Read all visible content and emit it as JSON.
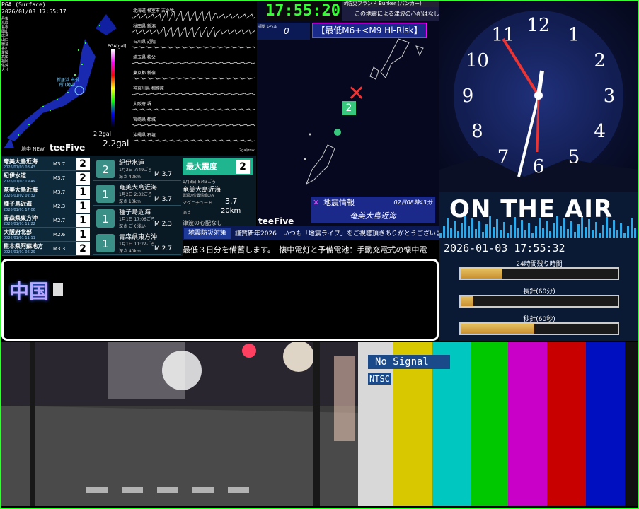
{
  "pga": {
    "header": "PGA (Surface)",
    "datetime": "2026/01/03 17:55:17",
    "legend": [
      "丹後",
      "鳥取",
      "島根",
      "岡山",
      "広島",
      "山口",
      "徳島",
      "香川",
      "愛媛",
      "高知",
      "福岡",
      "佐賀",
      "大分"
    ],
    "scale_label": "PGA[gal]",
    "gal_small": "2.2gal",
    "place": "新居浜 市役所 (地中)"
  },
  "waveforms": {
    "stations": [
      "北海道 根室市 古小牧",
      "秋田県 新潟",
      "石川県 近院",
      "埼玉県 秩父",
      "東京都 新宿",
      "神奈川県 相模原",
      "大阪府 堺",
      "宮崎県 都城",
      "沖縄県 石垣"
    ],
    "gal_big": "2.2gal",
    "brand": "teeFive",
    "new_label": "地中 NEW",
    "unit": "2gal/row"
  },
  "eq_list": [
    {
      "name": "奄美大島近海",
      "date": "2026/01/03 08:43",
      "mag": "M3.7",
      "shindo": "2"
    },
    {
      "name": "紀伊水道",
      "date": "2026/01/02 19:49",
      "mag": "M3.7",
      "shindo": "2"
    },
    {
      "name": "奄美大島近海",
      "date": "2026/01/02 02:32",
      "mag": "M3.7",
      "shindo": "1"
    },
    {
      "name": "種子島近海",
      "date": "2026/01/01 17:06",
      "mag": "M2.3",
      "shindo": "1"
    },
    {
      "name": "青森県東方沖",
      "date": "2026/01/01 11:22",
      "mag": "M2.7",
      "shindo": "1"
    },
    {
      "name": "大阪府北部",
      "date": "2026/01/01 11:11",
      "mag": "M2.6",
      "shindo": "1"
    },
    {
      "name": "熊本県阿蘇地方",
      "date": "2026/01/01 06:29",
      "mag": "M3.3",
      "shindo": "2"
    }
  ],
  "eq_detail": [
    {
      "name": "紀伊水道",
      "date": "1月2日 7:49ごろ",
      "depth": "深さ 40km",
      "mag": "M 3.7",
      "shindo": "2"
    },
    {
      "name": "奄美大島近海",
      "date": "1月2日 2:32ごろ",
      "depth": "深さ 10km",
      "mag": "M 3.7",
      "shindo": "1"
    },
    {
      "name": "種子島近海",
      "date": "1月1日 17:06ごろ",
      "depth": "深さ ごく浅い",
      "mag": "M 2.3",
      "shindo": "1"
    },
    {
      "name": "青森県東方沖",
      "date": "1月1日 11:22ごろ",
      "depth": "深さ 40km",
      "mag": "M 2.7",
      "shindo": "1"
    }
  ],
  "eq_info": {
    "max_label": "最大震度",
    "max_value": "2",
    "time": "1月3日 8:43ごろ",
    "place": "奄美大島近海",
    "note": "震源の位置情報のみ",
    "mag_label": "マグニチュード",
    "mag_value": "3.7",
    "depth_label": "深さ",
    "depth_value": "20km",
    "tsunami": "津波の心配なし"
  },
  "map": {
    "clock": "17:55:20",
    "bunker": "#防災ブランド Bunker (バンカー)",
    "tsunami": "この地震による津波の心配はなし",
    "level_label": "振動 レベル",
    "level_value": "0",
    "risk": "【最低M6+<M9 Hi-Risk】",
    "marker_shindo": "2",
    "info_title": "地震情報",
    "info_time": "02日08時43分",
    "info_loc": "奄美大島近海",
    "brand": "teeFive"
  },
  "ticker": {
    "label": "地震防災対策",
    "line1": "謹賀新年2026　いつも「地震ライブ」をご視聴頂きありがとうございます!",
    "line2": "最低３日分を備蓄します。　懐中電灯と予備電池：手動充電式の懐中電"
  },
  "textbox": {
    "text": "中国"
  },
  "clock_numbers": [
    "12",
    "1",
    "2",
    "3",
    "4",
    "5",
    "6",
    "7",
    "8",
    "9",
    "10",
    "11"
  ],
  "onair": {
    "title": "ON THE AIR",
    "datetime": "2026-01-03 17:55:32",
    "bars": [
      {
        "label": "24時間残り時間",
        "fill": 0.26
      },
      {
        "label": "長針(60分)",
        "fill": 0.08
      },
      {
        "label": "秒針(60秒)",
        "fill": 0.47
      }
    ]
  },
  "signal": {
    "no_signal": "No Signal",
    "format": "NTSC"
  },
  "colors": {
    "frame_green": "#33ff33",
    "accent_green": "#1fb58e"
  }
}
